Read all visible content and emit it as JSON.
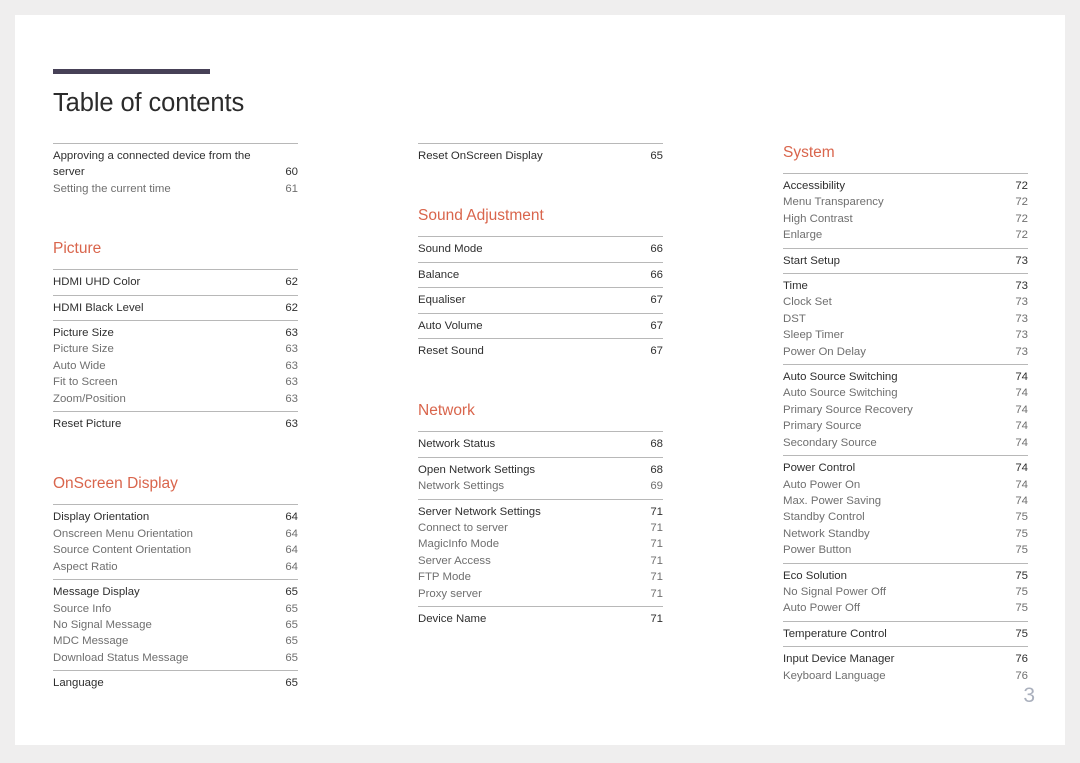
{
  "document": {
    "title": "Table of contents",
    "page_number": "3",
    "accent_color": "#d9654c",
    "rule_color": "#474157",
    "page_number_color": "#aab0bd"
  },
  "columns": [
    {
      "name": "column-1",
      "sections": [
        {
          "heading": null,
          "groups": [
            {
              "rows": [
                {
                  "label": "Approving a connected device from the server",
                  "page": "60",
                  "level": 1
                },
                {
                  "label": "Setting the current time",
                  "page": "61",
                  "level": 2
                }
              ]
            }
          ]
        },
        {
          "heading": "Picture",
          "groups": [
            {
              "rows": [
                {
                  "label": "HDMI UHD Color",
                  "page": "62",
                  "level": 1
                }
              ]
            },
            {
              "rows": [
                {
                  "label": "HDMI Black Level",
                  "page": "62",
                  "level": 1
                }
              ]
            },
            {
              "rows": [
                {
                  "label": "Picture Size",
                  "page": "63",
                  "level": 1
                },
                {
                  "label": "Picture Size",
                  "page": "63",
                  "level": 2
                },
                {
                  "label": "Auto Wide",
                  "page": "63",
                  "level": 2
                },
                {
                  "label": "Fit to Screen",
                  "page": "63",
                  "level": 2
                },
                {
                  "label": "Zoom/Position",
                  "page": "63",
                  "level": 2
                }
              ]
            },
            {
              "rows": [
                {
                  "label": "Reset Picture",
                  "page": "63",
                  "level": 1
                }
              ]
            }
          ]
        },
        {
          "heading": "OnScreen Display",
          "groups": [
            {
              "rows": [
                {
                  "label": "Display Orientation",
                  "page": "64",
                  "level": 1
                },
                {
                  "label": "Onscreen Menu Orientation",
                  "page": "64",
                  "level": 2
                },
                {
                  "label": "Source Content Orientation",
                  "page": "64",
                  "level": 2
                },
                {
                  "label": "Aspect Ratio",
                  "page": "64",
                  "level": 2
                }
              ]
            },
            {
              "rows": [
                {
                  "label": "Message Display",
                  "page": "65",
                  "level": 1
                },
                {
                  "label": "Source Info",
                  "page": "65",
                  "level": 2
                },
                {
                  "label": "No Signal Message",
                  "page": "65",
                  "level": 2
                },
                {
                  "label": "MDC Message",
                  "page": "65",
                  "level": 2
                },
                {
                  "label": "Download Status Message",
                  "page": "65",
                  "level": 2
                }
              ]
            },
            {
              "rows": [
                {
                  "label": "Language",
                  "page": "65",
                  "level": 1
                }
              ]
            }
          ]
        }
      ]
    },
    {
      "name": "column-2",
      "sections": [
        {
          "heading": null,
          "groups": [
            {
              "rows": [
                {
                  "label": "Reset OnScreen Display",
                  "page": "65",
                  "level": 1
                }
              ]
            }
          ]
        },
        {
          "heading": "Sound Adjustment",
          "groups": [
            {
              "rows": [
                {
                  "label": "Sound Mode",
                  "page": "66",
                  "level": 1
                }
              ]
            },
            {
              "rows": [
                {
                  "label": "Balance",
                  "page": "66",
                  "level": 1
                }
              ]
            },
            {
              "rows": [
                {
                  "label": "Equaliser",
                  "page": "67",
                  "level": 1
                }
              ]
            },
            {
              "rows": [
                {
                  "label": "Auto Volume",
                  "page": "67",
                  "level": 1
                }
              ]
            },
            {
              "rows": [
                {
                  "label": "Reset Sound",
                  "page": "67",
                  "level": 1
                }
              ]
            }
          ]
        },
        {
          "heading": "Network",
          "groups": [
            {
              "rows": [
                {
                  "label": "Network Status",
                  "page": "68",
                  "level": 1
                }
              ]
            },
            {
              "rows": [
                {
                  "label": "Open Network Settings",
                  "page": "68",
                  "level": 1
                },
                {
                  "label": "Network Settings",
                  "page": "69",
                  "level": 2
                }
              ]
            },
            {
              "rows": [
                {
                  "label": "Server Network Settings",
                  "page": "71",
                  "level": 1
                },
                {
                  "label": "Connect to server",
                  "page": "71",
                  "level": 2
                },
                {
                  "label": "MagicInfo Mode",
                  "page": "71",
                  "level": 2
                },
                {
                  "label": "Server Access",
                  "page": "71",
                  "level": 2
                },
                {
                  "label": "FTP Mode",
                  "page": "71",
                  "level": 2
                },
                {
                  "label": "Proxy server",
                  "page": "71",
                  "level": 2
                }
              ]
            },
            {
              "rows": [
                {
                  "label": "Device Name",
                  "page": "71",
                  "level": 1
                }
              ]
            }
          ]
        }
      ]
    },
    {
      "name": "column-3",
      "sections": [
        {
          "heading": "System",
          "groups": [
            {
              "rows": [
                {
                  "label": "Accessibility",
                  "page": "72",
                  "level": 1
                },
                {
                  "label": "Menu Transparency",
                  "page": "72",
                  "level": 2
                },
                {
                  "label": "High Contrast",
                  "page": "72",
                  "level": 2
                },
                {
                  "label": "Enlarge",
                  "page": "72",
                  "level": 2
                }
              ]
            },
            {
              "rows": [
                {
                  "label": "Start Setup",
                  "page": "73",
                  "level": 1
                }
              ]
            },
            {
              "rows": [
                {
                  "label": "Time",
                  "page": "73",
                  "level": 1
                },
                {
                  "label": "Clock Set",
                  "page": "73",
                  "level": 2
                },
                {
                  "label": "DST",
                  "page": "73",
                  "level": 2
                },
                {
                  "label": "Sleep Timer",
                  "page": "73",
                  "level": 2
                },
                {
                  "label": "Power On Delay",
                  "page": "73",
                  "level": 2
                }
              ]
            },
            {
              "rows": [
                {
                  "label": "Auto Source Switching",
                  "page": "74",
                  "level": 1
                },
                {
                  "label": "Auto Source Switching",
                  "page": "74",
                  "level": 2
                },
                {
                  "label": "Primary Source Recovery",
                  "page": "74",
                  "level": 2
                },
                {
                  "label": "Primary Source",
                  "page": "74",
                  "level": 2
                },
                {
                  "label": "Secondary Source",
                  "page": "74",
                  "level": 2
                }
              ]
            },
            {
              "rows": [
                {
                  "label": "Power Control",
                  "page": "74",
                  "level": 1
                },
                {
                  "label": "Auto Power On",
                  "page": "74",
                  "level": 2
                },
                {
                  "label": "Max. Power Saving",
                  "page": "74",
                  "level": 2
                },
                {
                  "label": "Standby Control",
                  "page": "75",
                  "level": 2
                },
                {
                  "label": "Network Standby",
                  "page": "75",
                  "level": 2
                },
                {
                  "label": "Power Button",
                  "page": "75",
                  "level": 2
                }
              ]
            },
            {
              "rows": [
                {
                  "label": "Eco Solution",
                  "page": "75",
                  "level": 1
                },
                {
                  "label": "No Signal Power Off",
                  "page": "75",
                  "level": 2
                },
                {
                  "label": "Auto Power Off",
                  "page": "75",
                  "level": 2
                }
              ]
            },
            {
              "rows": [
                {
                  "label": "Temperature Control",
                  "page": "75",
                  "level": 1
                }
              ]
            },
            {
              "rows": [
                {
                  "label": "Input Device Manager",
                  "page": "76",
                  "level": 1
                },
                {
                  "label": "Keyboard Language",
                  "page": "76",
                  "level": 2
                }
              ]
            }
          ]
        }
      ]
    }
  ]
}
